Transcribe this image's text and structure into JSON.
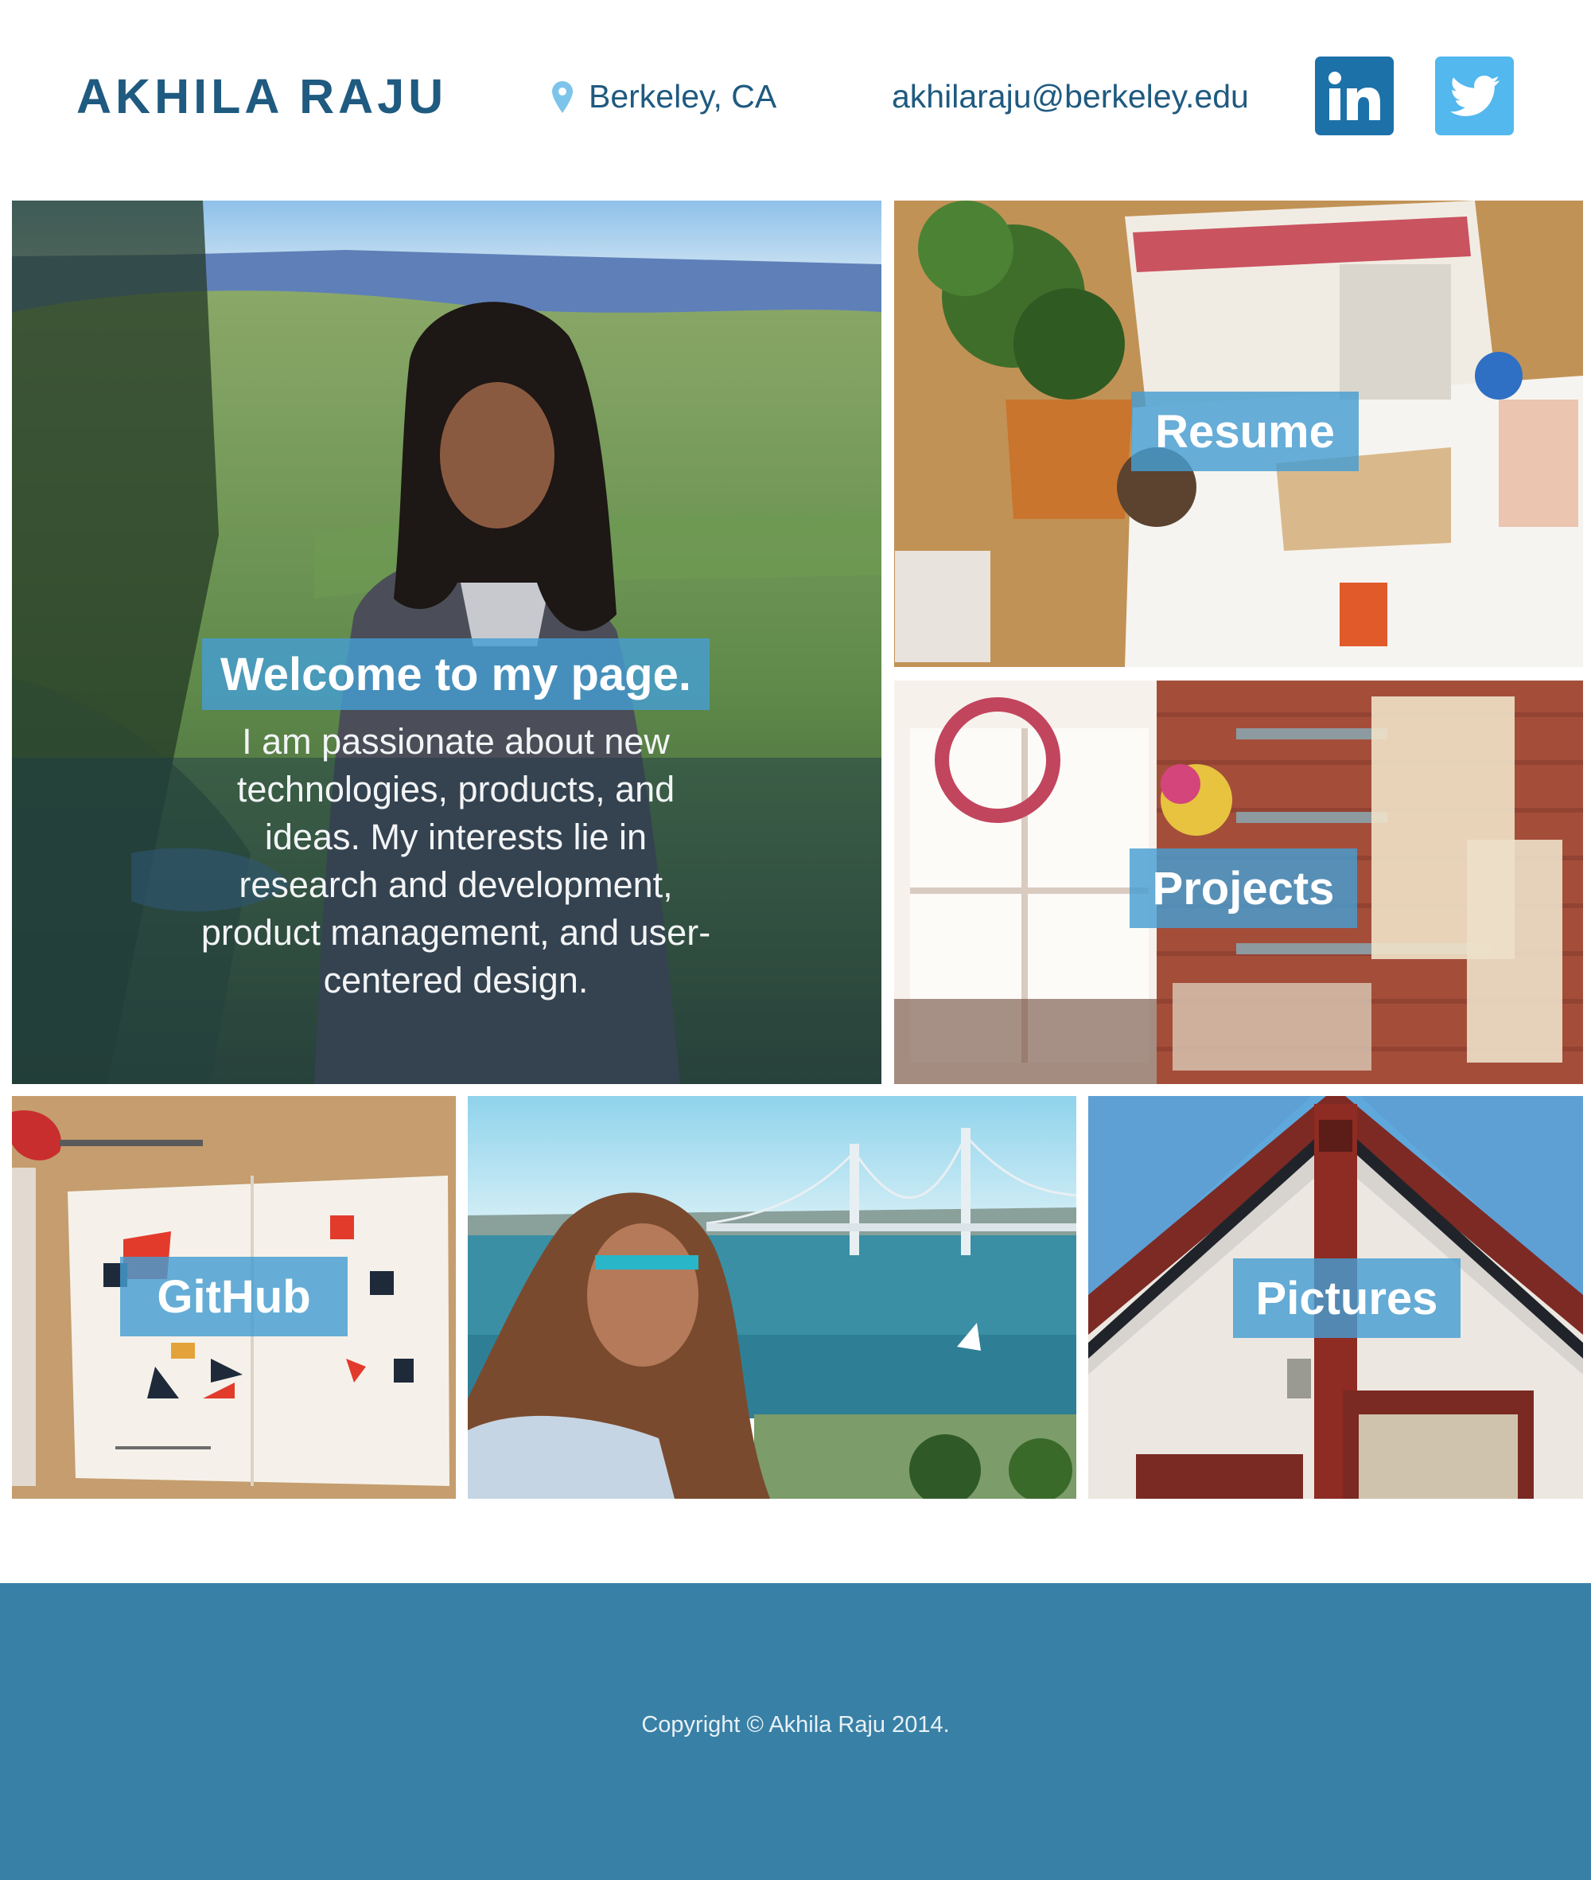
{
  "header": {
    "brand": "AKHILA RAJU",
    "location": "Berkeley, CA",
    "email": "akhilaraju@berkeley.edu",
    "location_icon": "map-pin-icon",
    "linkedin_icon": "linkedin-icon",
    "twitter_icon": "twitter-icon"
  },
  "hero": {
    "title": "Welcome to my page.",
    "text": "I am passionate about new technologies, products, and ideas. My interests lie in research and development, product management, and user-centered design."
  },
  "tiles": {
    "resume": "Resume",
    "projects": "Projects",
    "github": "GitHub",
    "pictures": "Pictures"
  },
  "footer": {
    "copyright": "Copyright © Akhila Raju 2014."
  },
  "colors": {
    "brand": "#1f5a80",
    "linkedin": "#1c71a9",
    "twitter": "#52b8ee",
    "label_overlay": "#469ed2",
    "footer": "#3880a6"
  }
}
